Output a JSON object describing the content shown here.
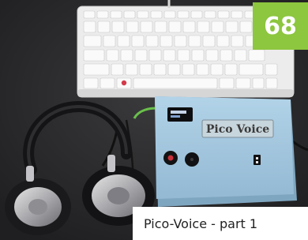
{
  "photo": {
    "subject": "Pico-Voice device with keyboard and headphones",
    "device_label": "Pico Voice"
  },
  "page_badge": "68",
  "caption": "Pico-Voice - part 1",
  "colors": {
    "badge": "#8dc63f",
    "table": "#2a2a2c",
    "enclosure": "#9fc3dc",
    "keyboard": "#eeeeee"
  }
}
